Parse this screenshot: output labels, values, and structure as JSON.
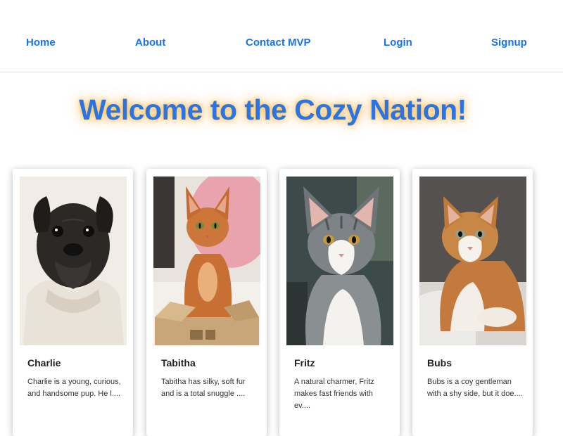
{
  "nav": {
    "home": "Home",
    "about": "About",
    "contact": "Contact MVP",
    "login": "Login",
    "signup": "Signup"
  },
  "hero": {
    "title": "Welcome to the Cozy Nation!"
  },
  "cards": [
    {
      "name": "Charlie",
      "description": "Charlie is a young, curious, and handsome pup. He l....",
      "image": "black-pug-in-blanket"
    },
    {
      "name": "Tabitha",
      "description": "Tabitha has silky, soft fur and is a total snuggle ....",
      "image": "orange-cat-in-box"
    },
    {
      "name": "Fritz",
      "description": "A natural charmer, Fritz makes fast friends with ev....",
      "image": "tabby-white-cat"
    },
    {
      "name": "Bubs",
      "description": "Bubs is a coy gentleman with a shy side, but it doe....",
      "image": "orange-white-cat-on-couch"
    }
  ],
  "colors": {
    "link": "#1a73e8",
    "title": "#2a74e6",
    "glow": "#ffb43c"
  }
}
